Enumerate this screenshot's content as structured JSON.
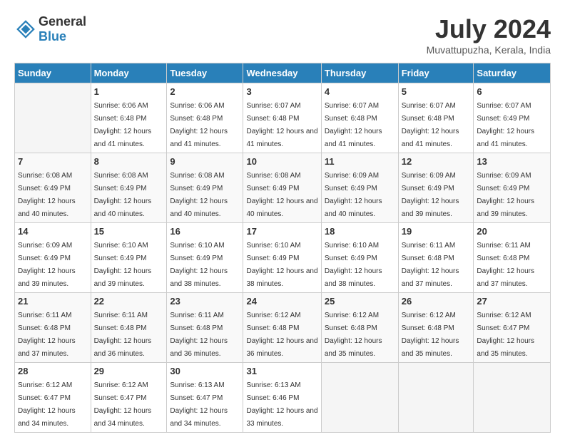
{
  "header": {
    "logo_general": "General",
    "logo_blue": "Blue",
    "month_year": "July 2024",
    "location": "Muvattupuzha, Kerala, India"
  },
  "weekdays": [
    "Sunday",
    "Monday",
    "Tuesday",
    "Wednesday",
    "Thursday",
    "Friday",
    "Saturday"
  ],
  "weeks": [
    [
      {
        "day": "",
        "sunrise": "",
        "sunset": "",
        "daylight": ""
      },
      {
        "day": "1",
        "sunrise": "Sunrise: 6:06 AM",
        "sunset": "Sunset: 6:48 PM",
        "daylight": "Daylight: 12 hours and 41 minutes."
      },
      {
        "day": "2",
        "sunrise": "Sunrise: 6:06 AM",
        "sunset": "Sunset: 6:48 PM",
        "daylight": "Daylight: 12 hours and 41 minutes."
      },
      {
        "day": "3",
        "sunrise": "Sunrise: 6:07 AM",
        "sunset": "Sunset: 6:48 PM",
        "daylight": "Daylight: 12 hours and 41 minutes."
      },
      {
        "day": "4",
        "sunrise": "Sunrise: 6:07 AM",
        "sunset": "Sunset: 6:48 PM",
        "daylight": "Daylight: 12 hours and 41 minutes."
      },
      {
        "day": "5",
        "sunrise": "Sunrise: 6:07 AM",
        "sunset": "Sunset: 6:48 PM",
        "daylight": "Daylight: 12 hours and 41 minutes."
      },
      {
        "day": "6",
        "sunrise": "Sunrise: 6:07 AM",
        "sunset": "Sunset: 6:49 PM",
        "daylight": "Daylight: 12 hours and 41 minutes."
      }
    ],
    [
      {
        "day": "7",
        "sunrise": "Sunrise: 6:08 AM",
        "sunset": "Sunset: 6:49 PM",
        "daylight": "Daylight: 12 hours and 40 minutes."
      },
      {
        "day": "8",
        "sunrise": "Sunrise: 6:08 AM",
        "sunset": "Sunset: 6:49 PM",
        "daylight": "Daylight: 12 hours and 40 minutes."
      },
      {
        "day": "9",
        "sunrise": "Sunrise: 6:08 AM",
        "sunset": "Sunset: 6:49 PM",
        "daylight": "Daylight: 12 hours and 40 minutes."
      },
      {
        "day": "10",
        "sunrise": "Sunrise: 6:08 AM",
        "sunset": "Sunset: 6:49 PM",
        "daylight": "Daylight: 12 hours and 40 minutes."
      },
      {
        "day": "11",
        "sunrise": "Sunrise: 6:09 AM",
        "sunset": "Sunset: 6:49 PM",
        "daylight": "Daylight: 12 hours and 40 minutes."
      },
      {
        "day": "12",
        "sunrise": "Sunrise: 6:09 AM",
        "sunset": "Sunset: 6:49 PM",
        "daylight": "Daylight: 12 hours and 39 minutes."
      },
      {
        "day": "13",
        "sunrise": "Sunrise: 6:09 AM",
        "sunset": "Sunset: 6:49 PM",
        "daylight": "Daylight: 12 hours and 39 minutes."
      }
    ],
    [
      {
        "day": "14",
        "sunrise": "Sunrise: 6:09 AM",
        "sunset": "Sunset: 6:49 PM",
        "daylight": "Daylight: 12 hours and 39 minutes."
      },
      {
        "day": "15",
        "sunrise": "Sunrise: 6:10 AM",
        "sunset": "Sunset: 6:49 PM",
        "daylight": "Daylight: 12 hours and 39 minutes."
      },
      {
        "day": "16",
        "sunrise": "Sunrise: 6:10 AM",
        "sunset": "Sunset: 6:49 PM",
        "daylight": "Daylight: 12 hours and 38 minutes."
      },
      {
        "day": "17",
        "sunrise": "Sunrise: 6:10 AM",
        "sunset": "Sunset: 6:49 PM",
        "daylight": "Daylight: 12 hours and 38 minutes."
      },
      {
        "day": "18",
        "sunrise": "Sunrise: 6:10 AM",
        "sunset": "Sunset: 6:49 PM",
        "daylight": "Daylight: 12 hours and 38 minutes."
      },
      {
        "day": "19",
        "sunrise": "Sunrise: 6:11 AM",
        "sunset": "Sunset: 6:48 PM",
        "daylight": "Daylight: 12 hours and 37 minutes."
      },
      {
        "day": "20",
        "sunrise": "Sunrise: 6:11 AM",
        "sunset": "Sunset: 6:48 PM",
        "daylight": "Daylight: 12 hours and 37 minutes."
      }
    ],
    [
      {
        "day": "21",
        "sunrise": "Sunrise: 6:11 AM",
        "sunset": "Sunset: 6:48 PM",
        "daylight": "Daylight: 12 hours and 37 minutes."
      },
      {
        "day": "22",
        "sunrise": "Sunrise: 6:11 AM",
        "sunset": "Sunset: 6:48 PM",
        "daylight": "Daylight: 12 hours and 36 minutes."
      },
      {
        "day": "23",
        "sunrise": "Sunrise: 6:11 AM",
        "sunset": "Sunset: 6:48 PM",
        "daylight": "Daylight: 12 hours and 36 minutes."
      },
      {
        "day": "24",
        "sunrise": "Sunrise: 6:12 AM",
        "sunset": "Sunset: 6:48 PM",
        "daylight": "Daylight: 12 hours and 36 minutes."
      },
      {
        "day": "25",
        "sunrise": "Sunrise: 6:12 AM",
        "sunset": "Sunset: 6:48 PM",
        "daylight": "Daylight: 12 hours and 35 minutes."
      },
      {
        "day": "26",
        "sunrise": "Sunrise: 6:12 AM",
        "sunset": "Sunset: 6:48 PM",
        "daylight": "Daylight: 12 hours and 35 minutes."
      },
      {
        "day": "27",
        "sunrise": "Sunrise: 6:12 AM",
        "sunset": "Sunset: 6:47 PM",
        "daylight": "Daylight: 12 hours and 35 minutes."
      }
    ],
    [
      {
        "day": "28",
        "sunrise": "Sunrise: 6:12 AM",
        "sunset": "Sunset: 6:47 PM",
        "daylight": "Daylight: 12 hours and 34 minutes."
      },
      {
        "day": "29",
        "sunrise": "Sunrise: 6:12 AM",
        "sunset": "Sunset: 6:47 PM",
        "daylight": "Daylight: 12 hours and 34 minutes."
      },
      {
        "day": "30",
        "sunrise": "Sunrise: 6:13 AM",
        "sunset": "Sunset: 6:47 PM",
        "daylight": "Daylight: 12 hours and 34 minutes."
      },
      {
        "day": "31",
        "sunrise": "Sunrise: 6:13 AM",
        "sunset": "Sunset: 6:46 PM",
        "daylight": "Daylight: 12 hours and 33 minutes."
      },
      {
        "day": "",
        "sunrise": "",
        "sunset": "",
        "daylight": ""
      },
      {
        "day": "",
        "sunrise": "",
        "sunset": "",
        "daylight": ""
      },
      {
        "day": "",
        "sunrise": "",
        "sunset": "",
        "daylight": ""
      }
    ]
  ]
}
